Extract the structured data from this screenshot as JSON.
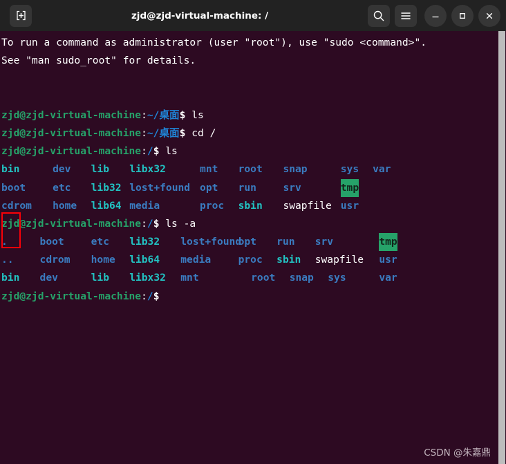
{
  "window": {
    "title": "zjd@zjd-virtual-machine: /",
    "titlebar_bg": "#222222",
    "terminal_bg": "#2d0a22",
    "buttons": {
      "new_tab": "new-tab-icon",
      "search": "search-icon",
      "menu": "hamburger-menu-icon",
      "minimize": "minimize-icon",
      "maximize": "maximize-icon",
      "close": "close-icon"
    }
  },
  "colors": {
    "user": "#26a269",
    "path": "#1f84d6",
    "directory": "#3a7bbf",
    "symlink": "#22c2c2",
    "file": "#ffffff",
    "tmp_bg": "#26a269",
    "annotation": "#fb0007",
    "scrollbar": "#bdbdbd"
  },
  "terminal": {
    "user_host": "zjd@zjd-virtual-machine",
    "prompt_sym": "$",
    "lines": [
      {
        "kind": "text",
        "text": "To run a command as administrator (user \"root\"), use \"sudo <command>\"."
      },
      {
        "kind": "text",
        "text": "See \"man sudo_root\" for details."
      },
      {
        "kind": "blank"
      },
      {
        "kind": "blank"
      },
      {
        "kind": "prompt",
        "path": "~/桌面",
        "command": "ls"
      },
      {
        "kind": "prompt",
        "path": "~/桌面",
        "command": "cd /"
      },
      {
        "kind": "prompt",
        "path": "/",
        "command": "ls"
      },
      {
        "kind": "ls",
        "cells": [
          {
            "text": "bin",
            "type": "symlink",
            "col": 0
          },
          {
            "text": "dev",
            "type": "dir",
            "col": 8
          },
          {
            "text": "lib",
            "type": "symlink",
            "col": 14
          },
          {
            "text": "libx32",
            "type": "symlink",
            "col": 20
          },
          {
            "text": "mnt",
            "type": "dir",
            "col": 31
          },
          {
            "text": "root",
            "type": "dir",
            "col": 37
          },
          {
            "text": "snap",
            "type": "dir",
            "col": 44
          },
          {
            "text": "sys",
            "type": "dir",
            "col": 53
          },
          {
            "text": "var",
            "type": "dir",
            "col": 58
          }
        ]
      },
      {
        "kind": "ls",
        "cells": [
          {
            "text": "boot",
            "type": "dir",
            "col": 0
          },
          {
            "text": "etc",
            "type": "dir",
            "col": 8
          },
          {
            "text": "lib32",
            "type": "symlink",
            "col": 14
          },
          {
            "text": "lost+found",
            "type": "dir",
            "col": 20
          },
          {
            "text": "opt",
            "type": "dir",
            "col": 31
          },
          {
            "text": "run",
            "type": "dir",
            "col": 37
          },
          {
            "text": "srv",
            "type": "dir",
            "col": 44
          },
          {
            "text": "tmp",
            "type": "tmp",
            "col": 53
          }
        ]
      },
      {
        "kind": "ls",
        "cells": [
          {
            "text": "cdrom",
            "type": "dir",
            "col": 0
          },
          {
            "text": "home",
            "type": "dir",
            "col": 8
          },
          {
            "text": "lib64",
            "type": "symlink",
            "col": 14
          },
          {
            "text": "media",
            "type": "dir",
            "col": 20
          },
          {
            "text": "proc",
            "type": "dir",
            "col": 31
          },
          {
            "text": "sbin",
            "type": "symlink",
            "col": 37
          },
          {
            "text": "swapfile",
            "type": "file",
            "col": 44
          },
          {
            "text": "usr",
            "type": "dir",
            "col": 53
          }
        ]
      },
      {
        "kind": "prompt",
        "path": "/",
        "command": "ls -a"
      },
      {
        "kind": "ls",
        "cells": [
          {
            "text": ".",
            "type": "dir",
            "col": 0
          },
          {
            "text": "boot",
            "type": "dir",
            "col": 6
          },
          {
            "text": "etc",
            "type": "dir",
            "col": 14
          },
          {
            "text": "lib32",
            "type": "symlink",
            "col": 20
          },
          {
            "text": "lost+found",
            "type": "dir",
            "col": 28
          },
          {
            "text": "opt",
            "type": "dir",
            "col": 37
          },
          {
            "text": "run",
            "type": "dir",
            "col": 43
          },
          {
            "text": "srv",
            "type": "dir",
            "col": 49
          },
          {
            "text": "tmp",
            "type": "tmp",
            "col": 59
          }
        ]
      },
      {
        "kind": "ls",
        "cells": [
          {
            "text": "..",
            "type": "dir",
            "col": 0
          },
          {
            "text": "cdrom",
            "type": "dir",
            "col": 6
          },
          {
            "text": "home",
            "type": "dir",
            "col": 14
          },
          {
            "text": "lib64",
            "type": "symlink",
            "col": 20
          },
          {
            "text": "media",
            "type": "dir",
            "col": 28
          },
          {
            "text": "proc",
            "type": "dir",
            "col": 37
          },
          {
            "text": "sbin",
            "type": "symlink",
            "col": 43
          },
          {
            "text": "swapfile",
            "type": "file",
            "col": 49
          },
          {
            "text": "usr",
            "type": "dir",
            "col": 59
          }
        ]
      },
      {
        "kind": "ls",
        "cells": [
          {
            "text": "bin",
            "type": "symlink",
            "col": 0
          },
          {
            "text": "dev",
            "type": "dir",
            "col": 6
          },
          {
            "text": "lib",
            "type": "symlink",
            "col": 14
          },
          {
            "text": "libx32",
            "type": "symlink",
            "col": 20
          },
          {
            "text": "mnt",
            "type": "dir",
            "col": 28
          },
          {
            "text": "root",
            "type": "dir",
            "col": 39
          },
          {
            "text": "snap",
            "type": "dir",
            "col": 45
          },
          {
            "text": "sys",
            "type": "dir",
            "col": 51
          },
          {
            "text": "var",
            "type": "dir",
            "col": 59
          }
        ]
      },
      {
        "kind": "prompt",
        "path": "/",
        "command": ""
      }
    ]
  },
  "watermark": {
    "text": "CSDN @朱嘉鼎"
  }
}
